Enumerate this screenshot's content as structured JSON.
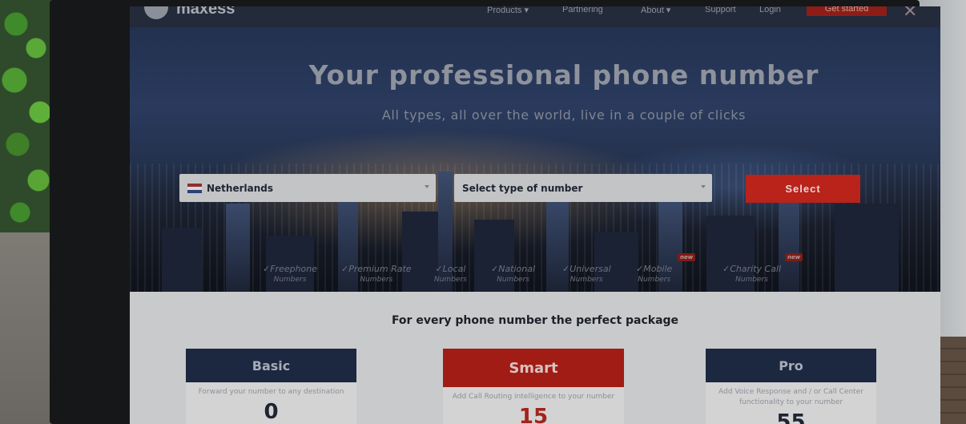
{
  "nav": {
    "logo": "maxess",
    "items": [
      "Products ▾",
      "Partnering",
      "About ▾",
      "Support",
      "Login"
    ],
    "cta": "Get started",
    "close": "✕"
  },
  "hero": {
    "title": "Your professional phone number",
    "subtitle": "All types, all over the world, live in a couple of clicks",
    "country_select": {
      "value": "Netherlands",
      "flag": "netherlands-flag"
    },
    "type_select": {
      "value": "Select type of number"
    },
    "select_button": "Select",
    "types": [
      {
        "label": "✓Freephone",
        "sub": "Numbers",
        "badge": ""
      },
      {
        "label": "✓Premium Rate",
        "sub": "Numbers",
        "badge": ""
      },
      {
        "label": "✓Local",
        "sub": "Numbers",
        "badge": ""
      },
      {
        "label": "✓National",
        "sub": "Numbers",
        "badge": ""
      },
      {
        "label": "✓Universal",
        "sub": "Numbers",
        "badge": ""
      },
      {
        "label": "✓Mobile",
        "sub": "Numbers",
        "badge": "new"
      },
      {
        "label": "✓Charity Call",
        "sub": "Numbers",
        "badge": "new"
      }
    ]
  },
  "packages": {
    "heading": "For every phone number the perfect package",
    "cards": [
      {
        "name": "Basic",
        "desc": "Forward your number to any destination",
        "price": "0"
      },
      {
        "name": "Smart",
        "desc": "Add Call Routing intelligence to your number",
        "price": "15"
      },
      {
        "name": "Pro",
        "desc": "Add Voice Response and / or Call Center functionality to your number",
        "price": "55"
      }
    ]
  },
  "colors": {
    "accent_red": "#b9231a",
    "navy": "#1c2740"
  }
}
